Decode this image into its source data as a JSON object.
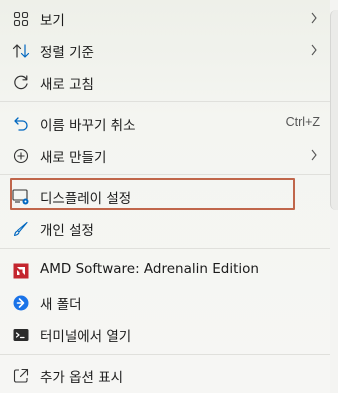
{
  "menu": {
    "items": [
      {
        "label": "보기",
        "icon": "grid-icon",
        "submenu": true
      },
      {
        "label": "정렬 기준",
        "icon": "sort-arrows-icon",
        "submenu": true
      },
      {
        "label": "새로 고침",
        "icon": "refresh-icon"
      },
      {
        "label": "이름 바꾸기 취소",
        "icon": "undo-icon",
        "shortcut": "Ctrl+Z"
      },
      {
        "label": "새로 만들기",
        "icon": "plus-circle-icon",
        "submenu": true
      },
      {
        "label": "디스플레이 설정",
        "icon": "display-settings-icon"
      },
      {
        "label": "개인 설정",
        "icon": "brush-icon"
      },
      {
        "label": "AMD Software: Adrenalin Edition",
        "icon": "amd-logo-icon"
      },
      {
        "label": "새 폴더",
        "icon": "new-folder-icon"
      },
      {
        "label": "터미널에서 열기",
        "icon": "terminal-icon"
      },
      {
        "label": "추가 옵션 표시",
        "icon": "expand-icon"
      }
    ]
  },
  "colors": {
    "highlight_border": "#c0664b",
    "accent_blue": "#0067c0",
    "amd_red": "#c4262e"
  }
}
